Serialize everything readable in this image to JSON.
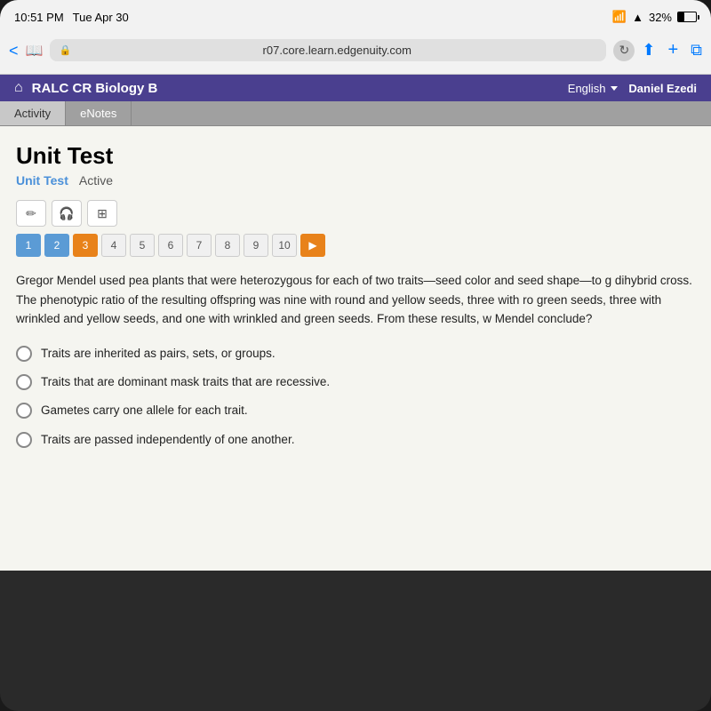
{
  "status_bar": {
    "time": "10:51 PM",
    "date": "Tue Apr 30",
    "wifi_signal": "WiFi",
    "network_bars": "▲",
    "battery_pct": "32%"
  },
  "browser": {
    "url": "r07.core.learn.edgenuity.com",
    "lock_icon": "🔒",
    "back_btn": "<",
    "reload_btn": "↻",
    "share_btn": "⬆",
    "plus_btn": "+",
    "tabs_btn": "⧉"
  },
  "app_header": {
    "home_icon": "⌂",
    "title": "RALC CR Biology B",
    "lang_label": "English",
    "user_name": "Daniel Ezedi"
  },
  "tabs": [
    {
      "label": "Activity",
      "active": true
    },
    {
      "label": "eNotes",
      "active": false
    }
  ],
  "page": {
    "title": "Unit Test",
    "subtitle_link": "Unit Test",
    "status": "Active"
  },
  "toolbar": {
    "pencil_icon": "✏",
    "headphone_icon": "🎧",
    "grid_icon": "⊞"
  },
  "question_nav": {
    "numbers": [
      "1",
      "2",
      "3",
      "4",
      "5",
      "6",
      "7",
      "8",
      "9",
      "10"
    ],
    "states": [
      "answered",
      "answered",
      "current",
      "default",
      "default",
      "default",
      "default",
      "default",
      "default",
      "default"
    ]
  },
  "question": {
    "text": "Gregor Mendel used pea plants that were heterozygous for each of two traits—seed color and seed shape—to g dihybrid cross. The phenotypic ratio of the resulting offspring was nine with round and yellow seeds, three with ro green seeds, three with wrinkled and yellow seeds, and one with wrinkled and green seeds. From these results, w Mendel conclude?",
    "choices": [
      "Traits are inherited as pairs, sets, or groups.",
      "Traits that are dominant mask traits that are recessive.",
      "Gametes carry one allele for each trait.",
      "Traits are passed independently of one another."
    ]
  }
}
